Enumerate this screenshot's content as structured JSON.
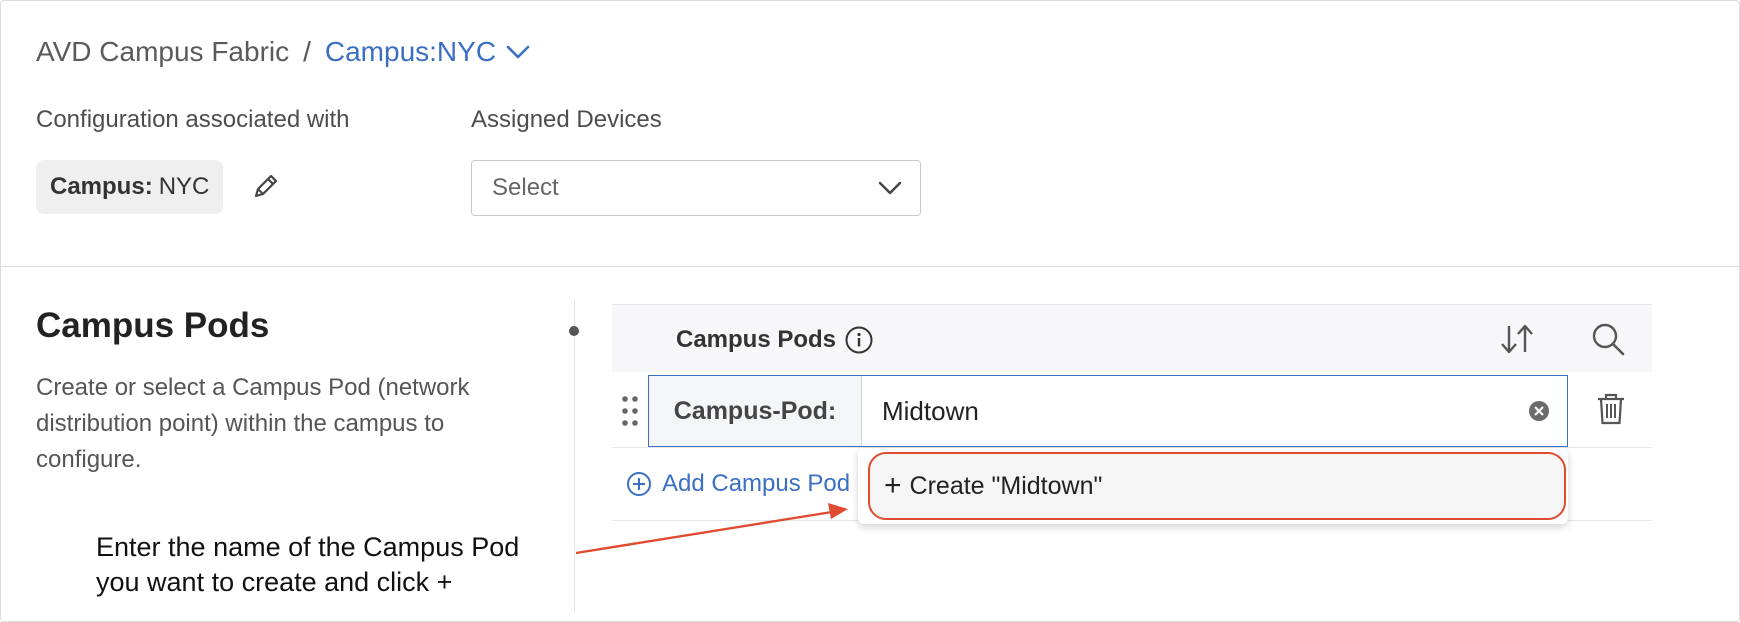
{
  "breadcrumb": {
    "root": "AVD Campus Fabric",
    "separator": "/",
    "current": "Campus:NYC"
  },
  "config": {
    "label": "Configuration associated with",
    "chip_key": "Campus:",
    "chip_value": "NYC"
  },
  "devices": {
    "label": "Assigned Devices",
    "placeholder": "Select"
  },
  "section": {
    "title": "Campus Pods",
    "description": "Create or select a Campus Pod (network distribution point) within the campus to configure."
  },
  "table": {
    "header": "Campus Pods",
    "row": {
      "prefix": "Campus-Pod:",
      "value": "Midtown"
    },
    "add_label": "Add Campus Pod"
  },
  "dropdown": {
    "option": "Create \"Midtown\""
  },
  "annotation": {
    "line1": "Enter the name of the Campus Pod",
    "line2": "you want to create and click +"
  },
  "colors": {
    "accent": "#3a6fc4",
    "highlight": "#e04a2f"
  }
}
